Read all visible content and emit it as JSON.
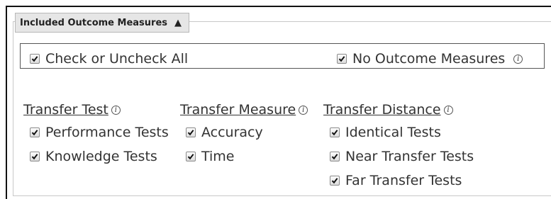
{
  "panel": {
    "title": "Included Outcome Measures",
    "collapse_icon": "triangle-up-icon"
  },
  "top_options": {
    "check_all": {
      "label": "Check or Uncheck All",
      "checked": true
    },
    "no_outcome": {
      "label": "No Outcome Measures",
      "checked": true,
      "icon": "info-icon"
    }
  },
  "groups": {
    "transfer_test": {
      "title": "Transfer Test",
      "items": [
        {
          "label": "Performance Tests",
          "checked": true
        },
        {
          "label": "Knowledge Tests",
          "checked": true
        }
      ]
    },
    "transfer_measure": {
      "title": "Transfer Measure",
      "items": [
        {
          "label": "Accuracy",
          "checked": true
        },
        {
          "label": "Time",
          "checked": true
        }
      ]
    },
    "transfer_distance": {
      "title": "Transfer Distance",
      "items": [
        {
          "label": "Identical Tests",
          "checked": true
        },
        {
          "label": "Near Transfer Tests",
          "checked": true
        },
        {
          "label": "Far Transfer Tests",
          "checked": true
        }
      ]
    }
  }
}
